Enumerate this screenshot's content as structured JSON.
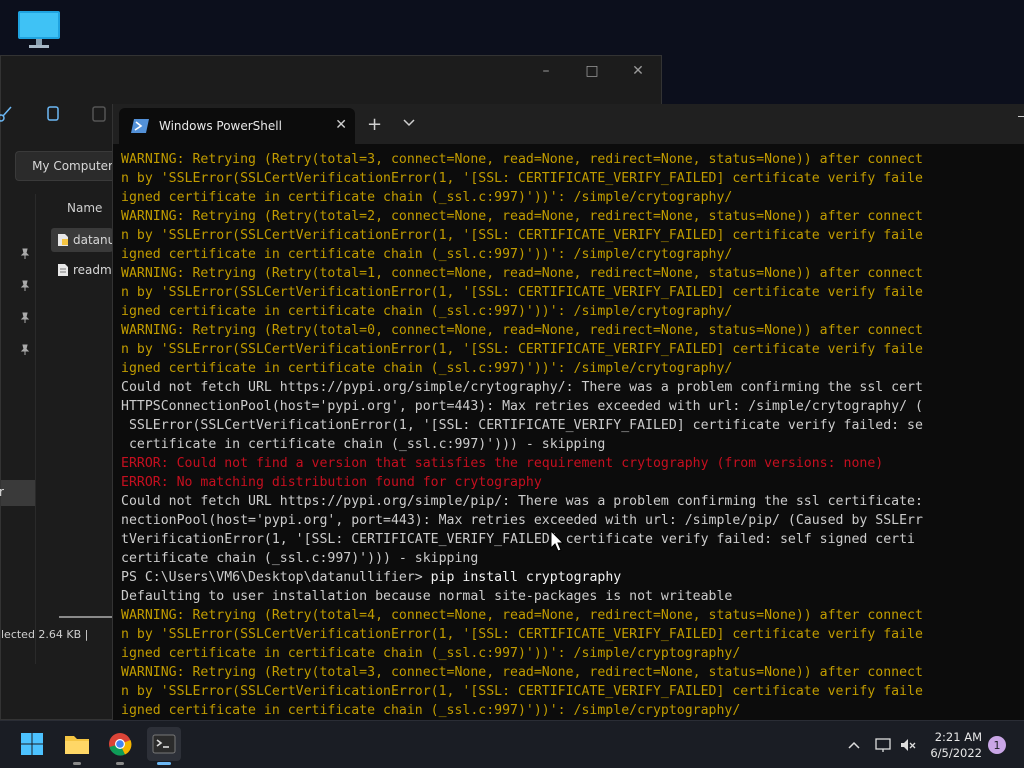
{
  "explorer": {
    "address": "My Computer",
    "column_name": "Name",
    "files": [
      {
        "name": "datanullifier",
        "selected": true
      },
      {
        "name": "readme",
        "selected": false
      }
    ],
    "nav_selected_text": "r",
    "status": "lected  2.64 KB   |",
    "icons": [
      "cut-icon",
      "copy-icon",
      "paste-icon",
      "folder-icon",
      "pin-icon"
    ]
  },
  "terminal": {
    "tab_title": "Windows PowerShell",
    "tab_close": "✕",
    "new_tab": "+",
    "dropdown": "⌄",
    "lines": [
      {
        "type": "warn",
        "text": "WARNING: Retrying (Retry(total=3, connect=None, read=None, redirect=None, status=None)) after connect"
      },
      {
        "type": "warn",
        "text": "n by 'SSLError(SSLCertVerificationError(1, '[SSL: CERTIFICATE_VERIFY_FAILED] certificate verify faile"
      },
      {
        "type": "warn",
        "text": "igned certificate in certificate chain (_ssl.c:997)'))': /simple/crytography/"
      },
      {
        "type": "warn",
        "text": "WARNING: Retrying (Retry(total=2, connect=None, read=None, redirect=None, status=None)) after connect"
      },
      {
        "type": "warn",
        "text": "n by 'SSLError(SSLCertVerificationError(1, '[SSL: CERTIFICATE_VERIFY_FAILED] certificate verify faile"
      },
      {
        "type": "warn",
        "text": "igned certificate in certificate chain (_ssl.c:997)'))': /simple/crytography/"
      },
      {
        "type": "warn",
        "text": "WARNING: Retrying (Retry(total=1, connect=None, read=None, redirect=None, status=None)) after connect"
      },
      {
        "type": "warn",
        "text": "n by 'SSLError(SSLCertVerificationError(1, '[SSL: CERTIFICATE_VERIFY_FAILED] certificate verify faile"
      },
      {
        "type": "warn",
        "text": "igned certificate in certificate chain (_ssl.c:997)'))': /simple/crytography/"
      },
      {
        "type": "warn",
        "text": "WARNING: Retrying (Retry(total=0, connect=None, read=None, redirect=None, status=None)) after connect"
      },
      {
        "type": "warn",
        "text": "n by 'SSLError(SSLCertVerificationError(1, '[SSL: CERTIFICATE_VERIFY_FAILED] certificate verify faile"
      },
      {
        "type": "warn",
        "text": "igned certificate in certificate chain (_ssl.c:997)'))': /simple/crytography/"
      },
      {
        "type": "out",
        "text": "Could not fetch URL https://pypi.org/simple/crytography/: There was a problem confirming the ssl cert"
      },
      {
        "type": "out",
        "text": "HTTPSConnectionPool(host='pypi.org', port=443): Max retries exceeded with url: /simple/crytography/ ("
      },
      {
        "type": "out",
        "text": " SSLError(SSLCertVerificationError(1, '[SSL: CERTIFICATE_VERIFY_FAILED] certificate verify failed: se"
      },
      {
        "type": "out",
        "text": " certificate in certificate chain (_ssl.c:997)'))) - skipping"
      },
      {
        "type": "err",
        "text": "ERROR: Could not find a version that satisfies the requirement crytography (from versions: none)"
      },
      {
        "type": "err",
        "text": "ERROR: No matching distribution found for crytography"
      },
      {
        "type": "out",
        "text": "Could not fetch URL https://pypi.org/simple/pip/: There was a problem confirming the ssl certificate:"
      },
      {
        "type": "out",
        "text": "nectionPool(host='pypi.org', port=443): Max retries exceeded with url: /simple/pip/ (Caused by SSLErr"
      },
      {
        "type": "out",
        "text": "tVerificationError(1, '[SSL: CERTIFICATE_VERIFY_FAILED] certificate verify failed: self signed certi"
      },
      {
        "type": "out",
        "text": "certificate chain (_ssl.c:997)'))) - skipping"
      },
      {
        "type": "cmd",
        "prompt": "PS C:\\Users\\VM6\\Desktop\\datanullifier> ",
        "text": "pip install cryptography"
      },
      {
        "type": "out",
        "text": "Defaulting to user installation because normal site-packages is not writeable"
      },
      {
        "type": "warn",
        "text": "WARNING: Retrying (Retry(total=4, connect=None, read=None, redirect=None, status=None)) after connect"
      },
      {
        "type": "warn",
        "text": "n by 'SSLError(SSLCertVerificationError(1, '[SSL: CERTIFICATE_VERIFY_FAILED] certificate verify faile"
      },
      {
        "type": "warn",
        "text": "igned certificate in certificate chain (_ssl.c:997)'))': /simple/cryptography/"
      },
      {
        "type": "warn",
        "text": "WARNING: Retrying (Retry(total=3, connect=None, read=None, redirect=None, status=None)) after connect"
      },
      {
        "type": "warn",
        "text": "n by 'SSLError(SSLCertVerificationError(1, '[SSL: CERTIFICATE_VERIFY_FAILED] certificate verify faile"
      },
      {
        "type": "warn",
        "text": "igned certificate in certificate chain (_ssl.c:997)'))': /simple/cryptography/"
      }
    ]
  },
  "taskbar": {
    "apps": [
      "windows-start-icon",
      "file-explorer-icon",
      "chrome-icon",
      "terminal-icon"
    ],
    "time": "2:21 AM",
    "date": "6/5/2022",
    "notification_count": "1",
    "colors": {
      "warning": "#c19c00",
      "error": "#c50f1f",
      "text": "#cccccc"
    }
  }
}
